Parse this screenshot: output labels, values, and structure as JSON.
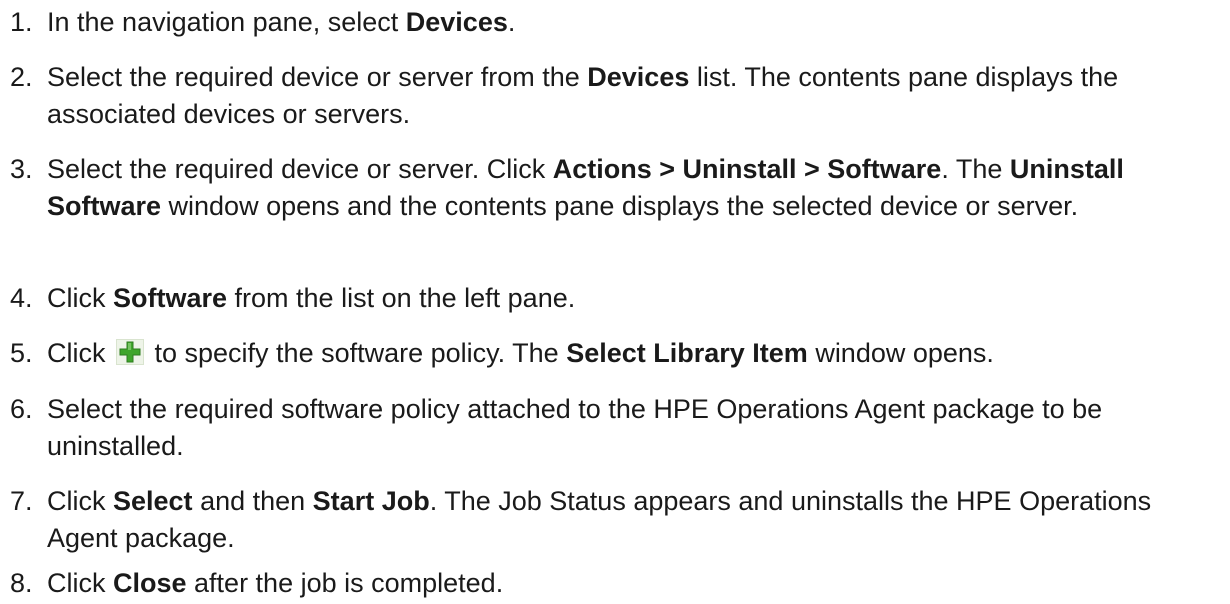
{
  "steps": [
    {
      "number": "1.",
      "parts": [
        {
          "text": "In the navigation pane, select "
        },
        {
          "text": "Devices",
          "bold": true
        },
        {
          "text": "."
        }
      ]
    },
    {
      "number": "2.",
      "parts": [
        {
          "text": "Select the required device or server from the "
        },
        {
          "text": "Devices",
          "bold": true
        },
        {
          "text": " list. The contents pane displays the associated devices or servers."
        }
      ]
    },
    {
      "number": "3.",
      "parts": [
        {
          "text": "Select the required device or server. Click "
        },
        {
          "text": "Actions > Uninstall > Software",
          "bold": true
        },
        {
          "text": ". The "
        },
        {
          "text": "Uninstall Software",
          "bold": true
        },
        {
          "text": " window opens and the contents pane displays the selected device or server."
        }
      ]
    },
    {
      "number": "4.",
      "parts": [
        {
          "text": "Click "
        },
        {
          "text": "Software",
          "bold": true
        },
        {
          "text": " from the list on the left pane."
        }
      ]
    },
    {
      "number": "5.",
      "parts": [
        {
          "text": "Click "
        },
        {
          "icon": "add-icon"
        },
        {
          "text": " to specify the software policy. The "
        },
        {
          "text": "Select Library Item",
          "bold": true
        },
        {
          "text": " window opens."
        }
      ]
    },
    {
      "number": "6.",
      "parts": [
        {
          "text": "Select the required software policy attached to the HPE Operations Agent package to be uninstalled."
        }
      ]
    },
    {
      "number": "7.",
      "parts": [
        {
          "text": "Click "
        },
        {
          "text": "Select",
          "bold": true
        },
        {
          "text": " and then "
        },
        {
          "text": "Start Job",
          "bold": true
        },
        {
          "text": ". The Job Status appears and uninstalls the HPE Operations Agent package."
        }
      ]
    },
    {
      "number": "8.",
      "parts": [
        {
          "text": "Click "
        },
        {
          "text": "Close",
          "bold": true
        },
        {
          "text": " after the job is completed."
        }
      ]
    }
  ],
  "colors": {
    "text": "#1a1a1a",
    "icon_green": "#3fa62b",
    "icon_background": "#eef4e8"
  }
}
